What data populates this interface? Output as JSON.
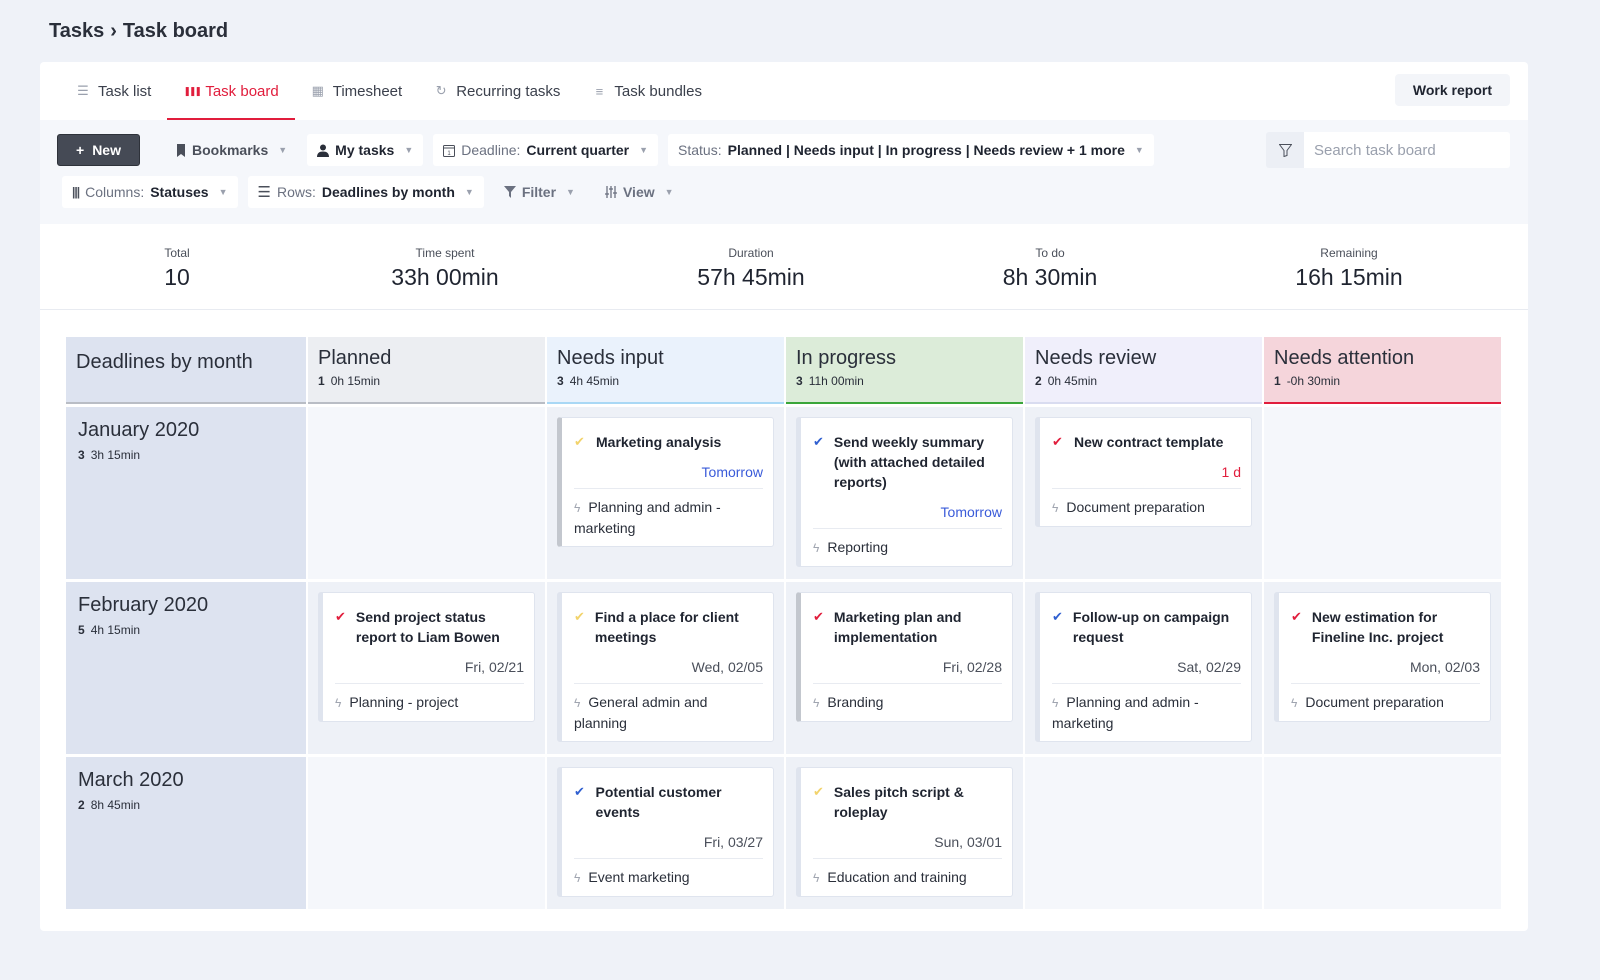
{
  "breadcrumb": {
    "parent": "Tasks",
    "separator": "›",
    "current": "Task board"
  },
  "tabs": [
    {
      "label": "Task list",
      "icon": "list-icon",
      "glyph": "☰",
      "active": false
    },
    {
      "label": "Task board",
      "icon": "board-columns-icon",
      "glyph": "❚❚❚",
      "active": true
    },
    {
      "label": "Timesheet",
      "icon": "grid-icon",
      "glyph": "▦",
      "active": false
    },
    {
      "label": "Recurring tasks",
      "icon": "refresh-icon",
      "glyph": "↻",
      "active": false
    },
    {
      "label": "Task bundles",
      "icon": "bundle-icon",
      "glyph": "≡",
      "active": false
    }
  ],
  "work_report_label": "Work report",
  "toolbar": {
    "new_label": "New",
    "bookmarks_label": "Bookmarks",
    "my_tasks_label": "My tasks",
    "deadline": {
      "key": "Deadline:",
      "value": "Current quarter"
    },
    "status": {
      "key": "Status:",
      "value": "Planned | Needs input | In progress | Needs review + 1 more"
    },
    "columns": {
      "key": "Columns:",
      "value": "Statuses"
    },
    "rows": {
      "key": "Rows:",
      "value": "Deadlines by month"
    },
    "filter_label": "Filter",
    "view_label": "View",
    "search_placeholder": "Search task board"
  },
  "stats": [
    {
      "label": "Total",
      "value": "10"
    },
    {
      "label": "Time spent",
      "value": "33h 00min"
    },
    {
      "label": "Duration",
      "value": "57h 45min"
    },
    {
      "label": "To do",
      "value": "8h 30min"
    },
    {
      "label": "Remaining",
      "value": "16h 15min"
    }
  ],
  "board": {
    "corner_label": "Deadlines by month",
    "columns": [
      {
        "title": "Planned",
        "count": "1",
        "time": "0h 15min",
        "bg": "#eceef2",
        "line": "#b9bdc5"
      },
      {
        "title": "Needs input",
        "count": "3",
        "time": "4h 45min",
        "bg": "#eaf2fc",
        "line": "#a9d8f5"
      },
      {
        "title": "In progress",
        "count": "3",
        "time": "11h 00min",
        "bg": "#dcecd9",
        "line": "#3aa63a"
      },
      {
        "title": "Needs review",
        "count": "2",
        "time": "0h 45min",
        "bg": "#f0effb",
        "line": "#d9dcf0"
      },
      {
        "title": "Needs attention",
        "count": "1",
        "time": "-0h 30min",
        "bg": "#f5d5db",
        "line": "#e11d3c"
      }
    ],
    "rows": [
      {
        "title": "January 2020",
        "count": "3",
        "time": "3h 15min",
        "cells": [
          [],
          [
            {
              "name": "Marketing analysis",
              "check": "yellow",
              "due": "Tomorrow",
              "due_style": "blue",
              "project": "Planning and admin - marketing",
              "bar": "grey"
            }
          ],
          [
            {
              "name": "Send weekly summary (with attached detailed reports)",
              "check": "blue",
              "due": "Tomorrow",
              "due_style": "blue",
              "project": "Reporting",
              "bar": "light"
            }
          ],
          [
            {
              "name": "New contract template",
              "check": "red",
              "due": "1 d",
              "due_style": "red",
              "project": "Document preparation",
              "bar": "light"
            }
          ],
          []
        ]
      },
      {
        "title": "February 2020",
        "count": "5",
        "time": "4h 15min",
        "cells": [
          [
            {
              "name": "Send project status report to Liam Bowen",
              "check": "red",
              "due": "Fri, 02/21",
              "due_style": "normal",
              "project": "Planning - project",
              "bar": "light"
            }
          ],
          [
            {
              "name": "Find a place for client meetings",
              "check": "yellow",
              "due": "Wed, 02/05",
              "due_style": "normal",
              "project": "General admin and planning",
              "bar": "light"
            }
          ],
          [
            {
              "name": "Marketing plan and implementation",
              "check": "red",
              "due": "Fri, 02/28",
              "due_style": "normal",
              "project": "Branding",
              "bar": "grey"
            }
          ],
          [
            {
              "name": "Follow-up on campaign request",
              "check": "blue",
              "due": "Sat, 02/29",
              "due_style": "normal",
              "project": "Planning and admin - marketing",
              "bar": "light"
            }
          ],
          [
            {
              "name": "New estimation for Fineline Inc. project",
              "check": "red",
              "due": "Mon, 02/03",
              "due_style": "normal",
              "project": "Document preparation",
              "bar": "light"
            }
          ]
        ]
      },
      {
        "title": "March 2020",
        "count": "2",
        "time": "8h 45min",
        "cells": [
          [],
          [
            {
              "name": "Potential customer events",
              "check": "blue",
              "due": "Fri, 03/27",
              "due_style": "normal",
              "project": "Event marketing",
              "bar": "light"
            }
          ],
          [
            {
              "name": "Sales pitch script & roleplay",
              "check": "yellow",
              "due": "Sun, 03/01",
              "due_style": "normal",
              "project": "Education and training",
              "bar": "light"
            }
          ],
          [],
          []
        ]
      }
    ]
  },
  "colors": {
    "accent": "#e11d3c",
    "check_red": "#e11d3c",
    "check_blue": "#2f5fd0",
    "check_yellow": "#f2d36b",
    "due_blue": "#3a5bd9"
  }
}
